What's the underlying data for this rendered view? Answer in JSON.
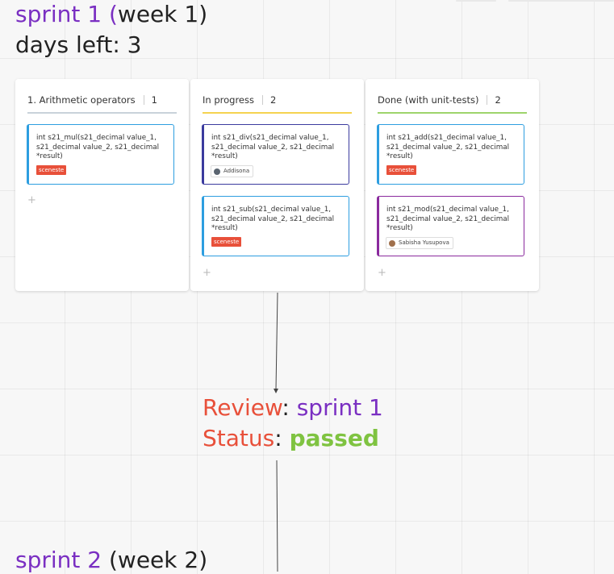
{
  "sprint1": {
    "label": "sprint 1",
    "paren_open": " (",
    "week": "week 1)"
  },
  "days_left": "days left: 3",
  "columns": [
    {
      "title": "1. Arithmetic operators",
      "count": "1",
      "cards": [
        {
          "text": "int s21_mul(s21_decimal value_1, s21_decimal value_2, s21_decimal *result)",
          "tag": "sceneste"
        }
      ]
    },
    {
      "title": "In progress",
      "count": "2",
      "cards": [
        {
          "text": "int s21_div(s21_decimal value_1, s21_decimal value_2, s21_decimal *result)",
          "user": "Addisona"
        },
        {
          "text": "int s21_sub(s21_decimal value_1, s21_decimal value_2, s21_decimal *result)",
          "tag": "sceneste"
        }
      ]
    },
    {
      "title": "Done (with unit-tests)",
      "count": "2",
      "cards": [
        {
          "text": "int s21_add(s21_decimal value_1, s21_decimal value_2, s21_decimal *result)",
          "tag": "sceneste"
        },
        {
          "text": "int s21_mod(s21_decimal value_1, s21_decimal value_2, s21_decimal *result)",
          "user": "Sabisha Yusupova"
        }
      ]
    }
  ],
  "add_symbol": "+",
  "review": {
    "label": "Review",
    "colon": ": ",
    "value": "sprint 1"
  },
  "status": {
    "label": "Status",
    "colon": ": ",
    "value": "passed"
  },
  "sprint2": {
    "label": "sprint 2",
    "week": " (week 2)"
  },
  "colors": {
    "purple": "#7a2fc2",
    "red": "#e8503a",
    "green": "#7fc341",
    "col0_rule": "#c9d2da",
    "col1_rule": "#f5d350",
    "col2_rule": "#9ed46c",
    "card_blue": "#2d9ee0",
    "card_indigo": "#3b3b9e",
    "card_magenta": "#8a2a9e"
  }
}
